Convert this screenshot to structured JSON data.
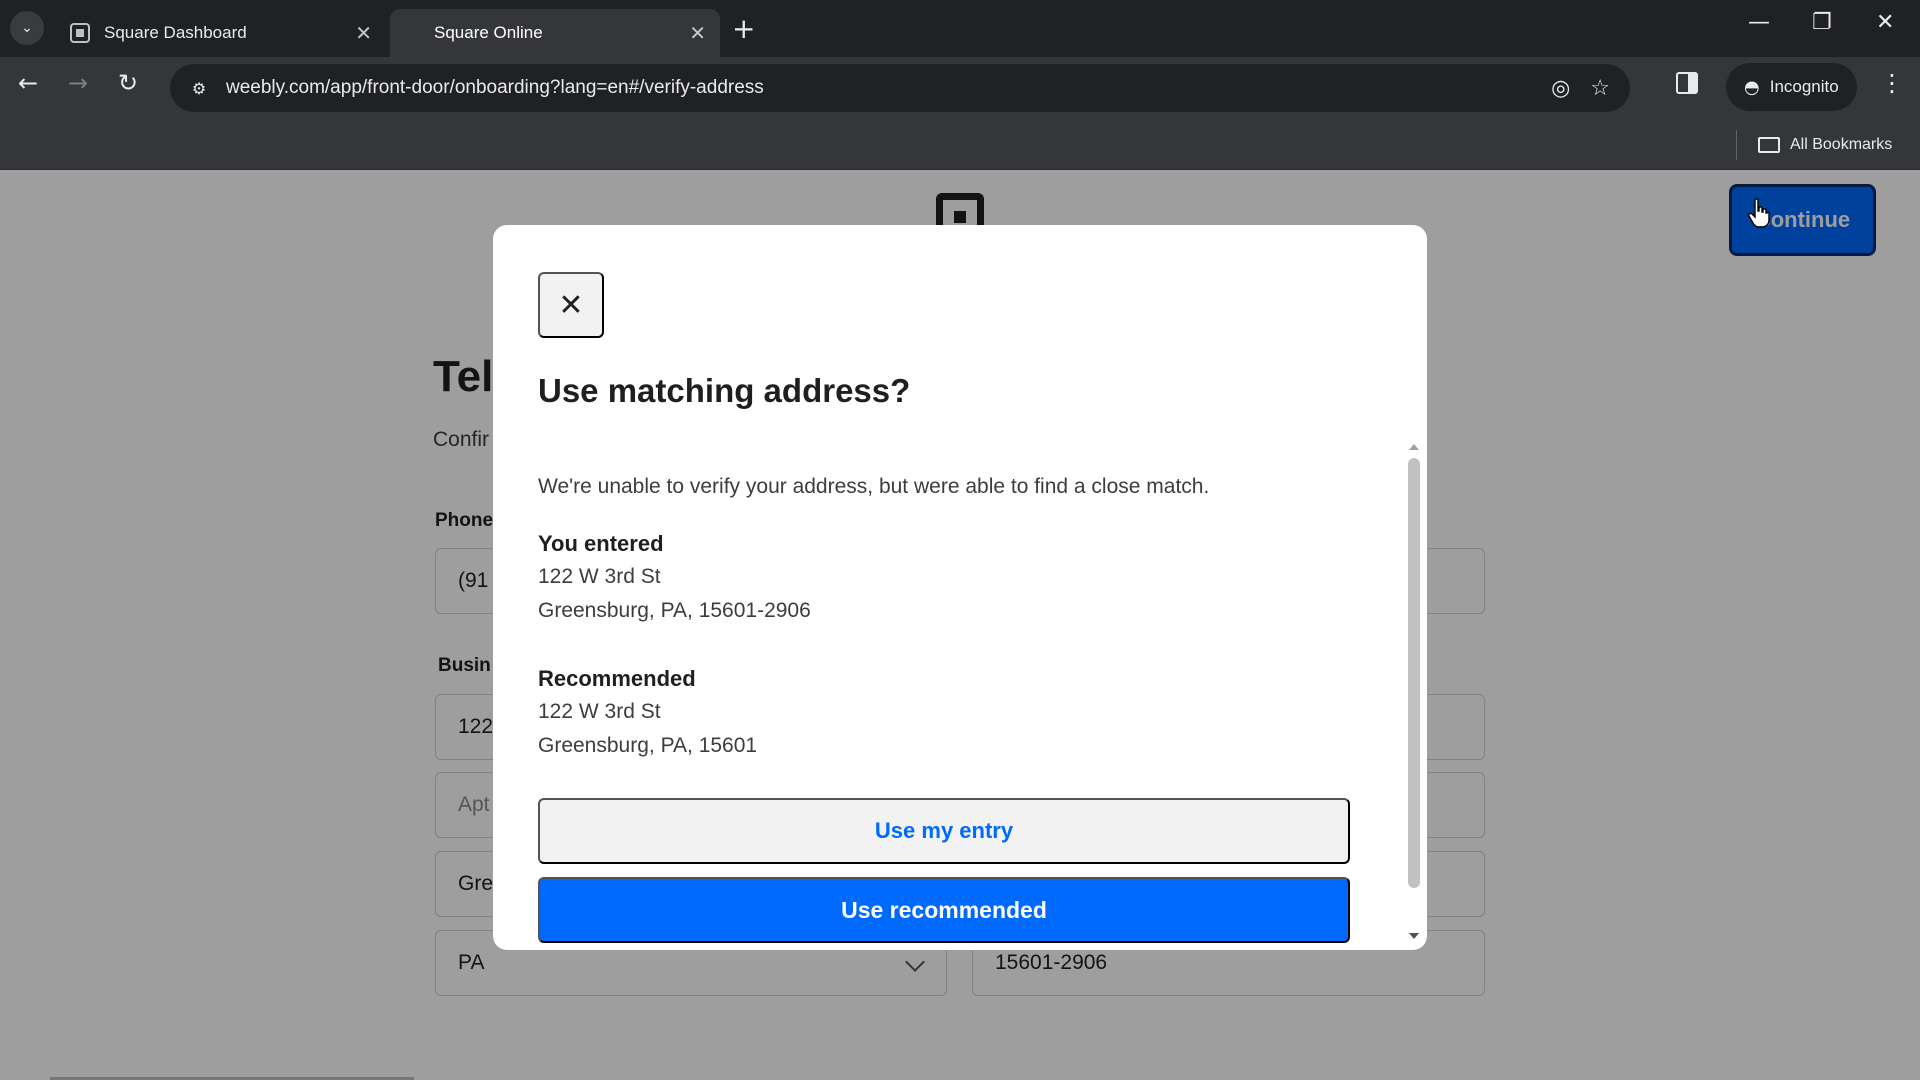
{
  "browser": {
    "tabs": [
      {
        "title": "Square Dashboard",
        "active": false
      },
      {
        "title": "Square Online",
        "active": true
      }
    ],
    "url": "weebly.com/app/front-door/onboarding?lang=en#/verify-address",
    "incognito_label": "Incognito",
    "bookmarks_label": "All Bookmarks"
  },
  "page": {
    "continue_label": "Continue",
    "heading": "Tell",
    "subtext": "Confir",
    "phone_label": "Phone",
    "phone_value": "(91",
    "business_label": "Busin",
    "address_value": "122",
    "apt_placeholder": "Apt",
    "city_value": "Gre",
    "state_value": "PA",
    "zip_value": "15601-2906"
  },
  "modal": {
    "title": "Use matching address?",
    "body": "We're unable to verify your address, but were able to find a close match.",
    "entered": {
      "heading": "You entered",
      "line1": "122 W 3rd St",
      "line2": "Greensburg, PA, 15601-2906"
    },
    "recommended": {
      "heading": "Recommended",
      "line1": "122 W 3rd St",
      "line2": "Greensburg, PA, 15601"
    },
    "use_entry_label": "Use my entry",
    "use_recommended_label": "Use recommended"
  },
  "colors": {
    "accent": "#006aff",
    "chrome_dark": "#202124",
    "chrome_mid": "#35363a"
  },
  "icons": [
    "square-logo-icon",
    "close-icon",
    "back-arrow-icon",
    "forward-arrow-icon",
    "reload-icon",
    "eye-off-icon",
    "star-icon",
    "side-panel-icon",
    "incognito-icon",
    "folder-icon"
  ]
}
